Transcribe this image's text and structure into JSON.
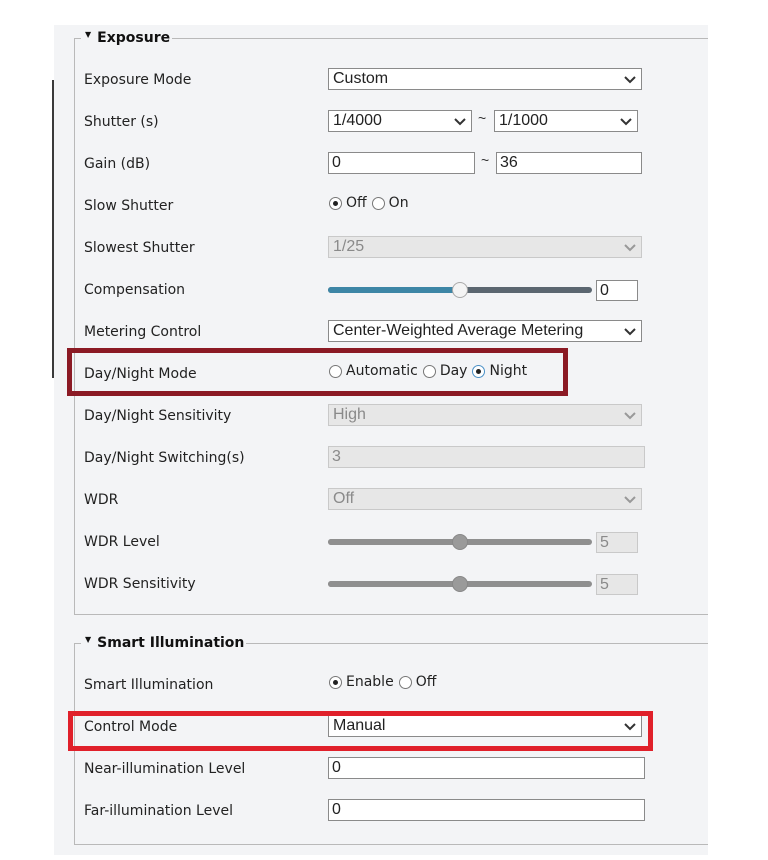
{
  "exposure": {
    "legend": "Exposure",
    "exposure_mode": {
      "label": "Exposure Mode",
      "value": "Custom"
    },
    "shutter": {
      "label": "Shutter (s)",
      "min": "1/4000",
      "max": "1/1000",
      "separator": "~"
    },
    "gain": {
      "label": "Gain (dB)",
      "min": "0",
      "max": "36",
      "separator": "~"
    },
    "slow_shutter": {
      "label": "Slow Shutter",
      "options": [
        "Off",
        "On"
      ],
      "selected": "Off"
    },
    "slowest_shutter": {
      "label": "Slowest Shutter",
      "value": "1/25"
    },
    "compensation": {
      "label": "Compensation",
      "value": "0",
      "fraction": 0.5
    },
    "metering_control": {
      "label": "Metering Control",
      "value": "Center-Weighted Average Metering"
    },
    "day_night_mode": {
      "label": "Day/Night Mode",
      "options": [
        "Automatic",
        "Day",
        "Night"
      ],
      "selected": "Night"
    },
    "day_night_sensitivity": {
      "label": "Day/Night Sensitivity",
      "value": "High"
    },
    "day_night_switching": {
      "label": "Day/Night Switching(s)",
      "value": "3"
    },
    "wdr": {
      "label": "WDR",
      "value": "Off"
    },
    "wdr_level": {
      "label": "WDR Level",
      "value": "5",
      "fraction": 0.5
    },
    "wdr_sensitivity": {
      "label": "WDR Sensitivity",
      "value": "5",
      "fraction": 0.5
    }
  },
  "smart_illumination": {
    "legend": "Smart Illumination",
    "smart_illumination": {
      "label": "Smart Illumination",
      "options": [
        "Enable",
        "Off"
      ],
      "selected": "Enable"
    },
    "control_mode": {
      "label": "Control Mode",
      "value": "Manual"
    },
    "near_level": {
      "label": "Near-illumination Level",
      "value": "0"
    },
    "far_level": {
      "label": "Far-illumination Level",
      "value": "0"
    }
  },
  "highlight_colors": {
    "day_night_box": "#8b1a24",
    "control_mode_box": "#e0202a"
  }
}
